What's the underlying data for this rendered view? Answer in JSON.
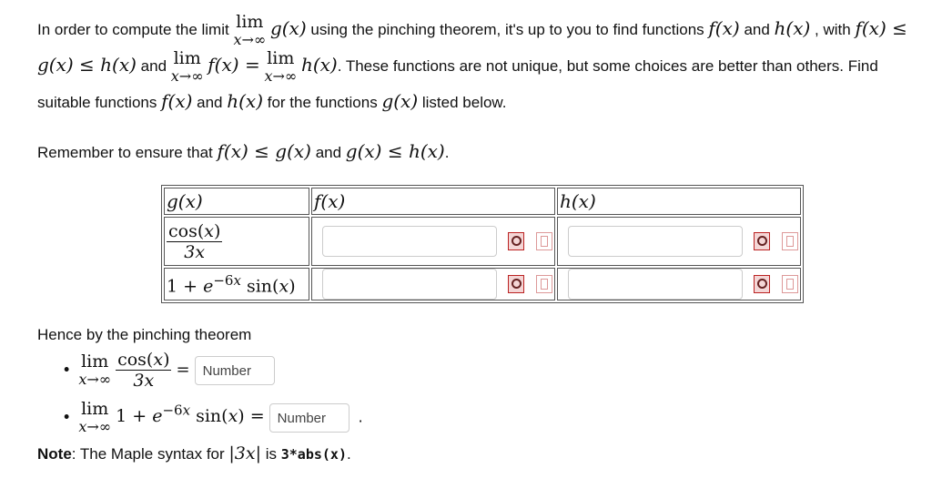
{
  "intro": {
    "t1": "In order to compute the limit",
    "t2": "using the pinching theorem, it's up to you to find functions",
    "t3": "and",
    "t4": "with",
    "t5": "and",
    "t6": ". These functions are not unique, but some choices are better than others. Find suitable functions",
    "t7": "for the functions",
    "t8": "listed below."
  },
  "remember": {
    "t1": "Remember to ensure that",
    "t2": "and"
  },
  "table": {
    "headers": [
      "g(x)",
      "f(x)",
      "h(x)"
    ],
    "rows": [
      {
        "g": "cos(x) / 3x"
      },
      {
        "g": "1 + e^(-6x) sin(x)"
      }
    ]
  },
  "hence": "Hence by the pinching theorem",
  "answers": {
    "placeholder1": "Number",
    "placeholder2": "Number"
  },
  "note": {
    "label": "Note",
    "text": ": The Maple syntax for",
    "text2": "is",
    "code": "3*abs(x)",
    "end": "."
  },
  "icons": [
    "preview-icon",
    "help-icon"
  ]
}
